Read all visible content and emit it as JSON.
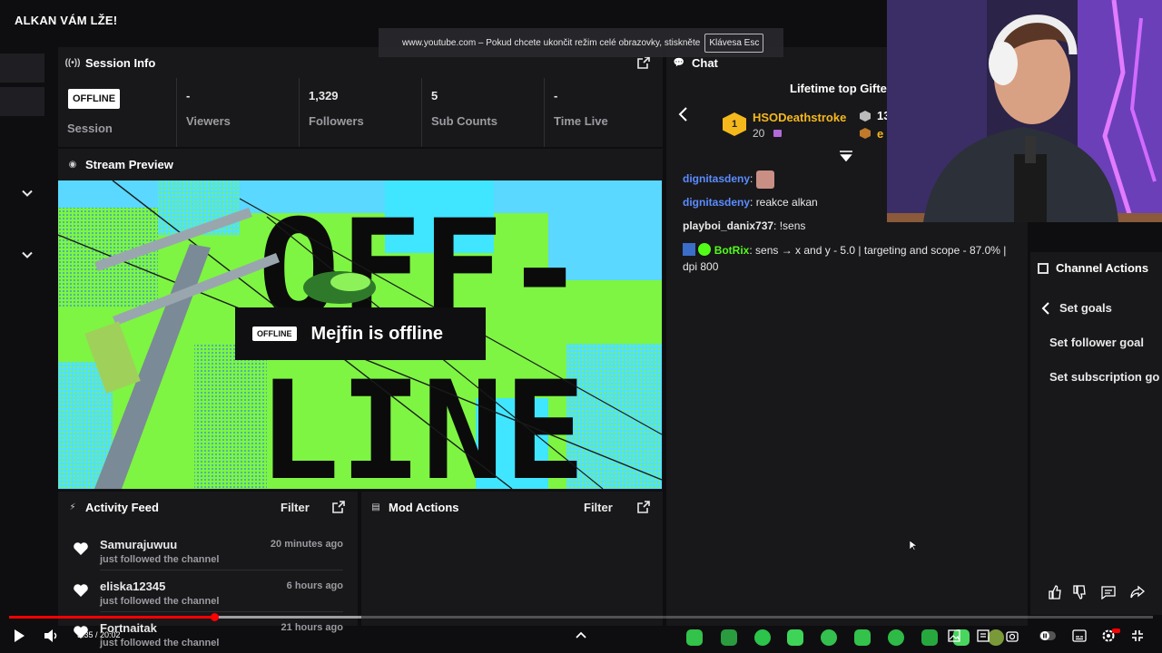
{
  "video": {
    "title": "ALKAN VÁM LŽE!",
    "time": "3:35 / 20:02",
    "progress_fraction": 0.179
  },
  "fullscreen_notice": {
    "text": "www.youtube.com – Pokud chcete ukončit režim celé obrazovky, stiskněte",
    "key": "Klávesa Esc"
  },
  "session": {
    "title": "Session Info",
    "badge": "OFFLINE",
    "stats": [
      {
        "value": "",
        "label": "Session"
      },
      {
        "value": "-",
        "label": "Viewers"
      },
      {
        "value": "1,329",
        "label": "Followers"
      },
      {
        "value": "5",
        "label": "Sub Counts"
      },
      {
        "value": "-",
        "label": "Time Live"
      }
    ]
  },
  "preview": {
    "title": "Stream Preview",
    "badge": "OFFLINE",
    "message": "Mejfin is offline",
    "art_line1": "OFF-",
    "art_line2": "LINE"
  },
  "activity": {
    "title": "Activity Feed",
    "filter": "Filter",
    "items": [
      {
        "name": "Samurajuwuu",
        "sub": "just followed the channel",
        "time": "20 minutes ago"
      },
      {
        "name": "eliska12345",
        "sub": "just followed the channel",
        "time": "6 hours ago"
      },
      {
        "name": "Fortnaitak",
        "sub": "just followed the channel",
        "time": "21 hours ago"
      }
    ]
  },
  "mod": {
    "title": "Mod Actions",
    "filter": "Filter"
  },
  "chat": {
    "title": "Chat",
    "gifter_title": "Lifetime top Gifte",
    "gifter_rank": "1",
    "gifter_name": "HSODeathstroke",
    "gifter_count": "20",
    "gifter_extra1": "13",
    "gifter_extra2": "e",
    "lines": [
      {
        "user": "dignitasdeny",
        "color": "#5b8cff",
        "text": ""
      },
      {
        "user": "dignitasdeny",
        "color": "#5b8cff",
        "text": "reakce alkan"
      },
      {
        "user": "playboi_danix737",
        "color": "#e8e8e8",
        "text": "!sens"
      },
      {
        "user": "BotRix",
        "color": "#53fc18",
        "text": "sens → x and y - 5.0 | targeting and scope - 87.0% | dpi 800"
      }
    ]
  },
  "actions": {
    "title": "Channel Actions",
    "back_label": "Set goals",
    "items": [
      "Set follower goal",
      "Set subscription go"
    ]
  },
  "colors": {
    "accent": "#53fc18",
    "panel": "#18181b",
    "bg": "#0e0e10",
    "progress": "#ff0000"
  }
}
